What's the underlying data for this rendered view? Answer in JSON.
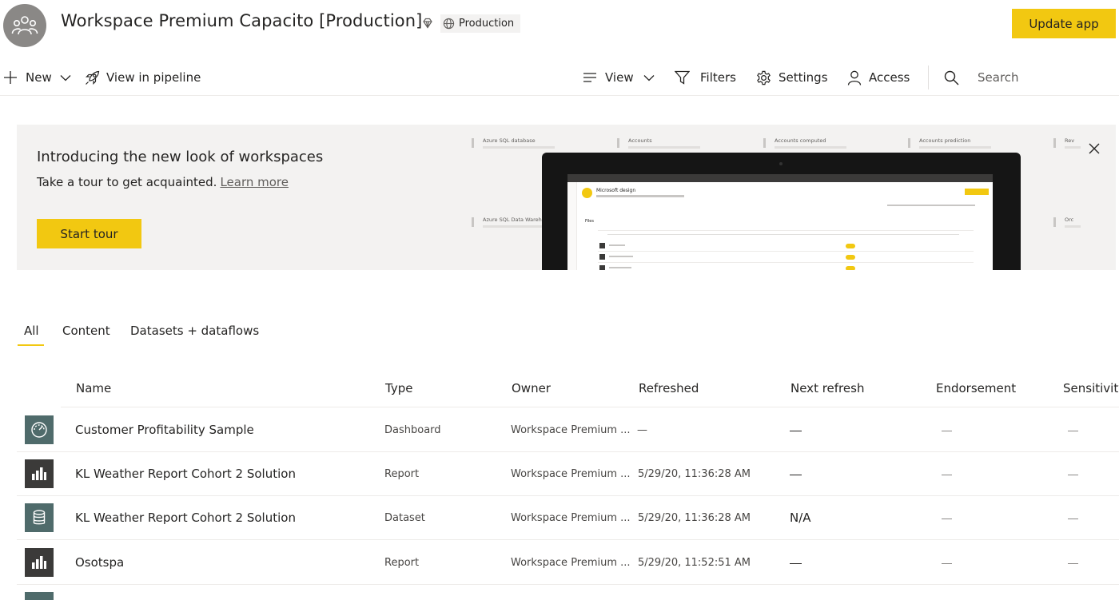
{
  "header": {
    "workspace_title": "Workspace Premium Capacito [Production]",
    "env_badge": "Production",
    "update_button": "Update app"
  },
  "toolbar": {
    "new": "New",
    "pipeline": "View in pipeline",
    "view": "View",
    "filters": "Filters",
    "settings": "Settings",
    "access": "Access",
    "search_placeholder": "Search"
  },
  "banner": {
    "title": "Introducing the new look of workspaces",
    "subtitle": "Take a tour to get acquainted.",
    "link": "Learn more",
    "button": "Start tour",
    "illustration": {
      "cards": [
        "Azure SQL database",
        "Accounts",
        "Accounts computed",
        "Accounts prediction",
        "Rev",
        "Azure SQL Data Warehouse",
        "Orc"
      ],
      "screen_title": "Microsoft design",
      "screen_section": "Files"
    }
  },
  "tabs": [
    "All",
    "Content",
    "Datasets + dataflows"
  ],
  "table": {
    "columns": [
      "Name",
      "Type",
      "Owner",
      "Refreshed",
      "Next refresh",
      "Endorsement",
      "Sensitivity"
    ],
    "rows": [
      {
        "name": "Customer Profitability Sample",
        "type": "Dashboard",
        "owner": "Workspace Premium ...",
        "refreshed": "—",
        "next_refresh": "—",
        "endorsement": "—",
        "sensitivity": "—",
        "icon": "dashboard-icon"
      },
      {
        "name": "KL Weather Report Cohort 2 Solution",
        "type": "Report",
        "owner": "Workspace Premium ...",
        "refreshed": "5/29/20, 11:36:28 AM",
        "next_refresh": "—",
        "endorsement": "—",
        "sensitivity": "—",
        "icon": "report-icon"
      },
      {
        "name": "KL Weather Report Cohort 2 Solution",
        "type": "Dataset",
        "owner": "Workspace Premium ...",
        "refreshed": "5/29/20, 11:36:28 AM",
        "next_refresh": "N/A",
        "endorsement": "—",
        "sensitivity": "—",
        "icon": "dataset-icon"
      },
      {
        "name": "Osotspa",
        "type": "Report",
        "owner": "Workspace Premium ...",
        "refreshed": "5/29/20, 11:52:51 AM",
        "next_refresh": "—",
        "endorsement": "—",
        "sensitivity": "—",
        "icon": "report-icon"
      }
    ]
  },
  "colors": {
    "accent_yellow": "#f2c811",
    "dataset_icon_bg": "#4f6b6b",
    "report_icon_bg": "#3b3a39"
  }
}
